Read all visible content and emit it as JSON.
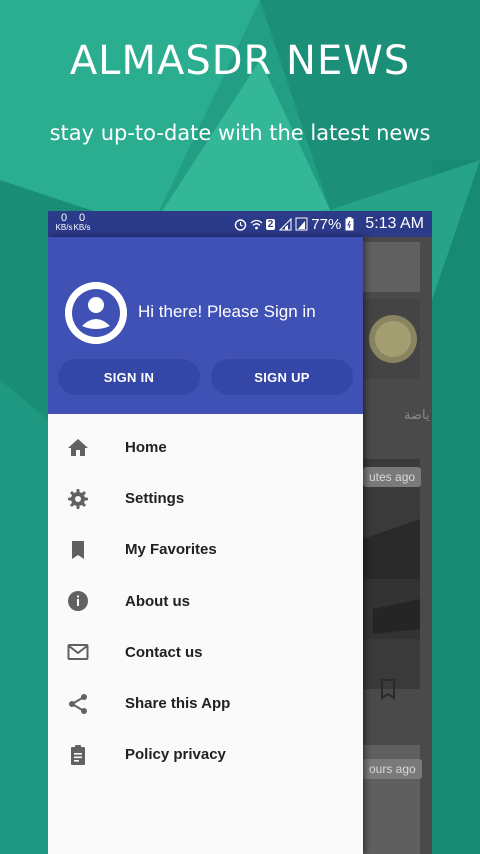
{
  "promo": {
    "title": "ALMASDR NEWS",
    "subtitle": "stay up-to-date with the latest news"
  },
  "statusbar": {
    "net_up": "0",
    "net_down": "0",
    "net_unit": "KB/s",
    "sim_badge": "2",
    "battery_percent": "77%",
    "time": "5:13 AM"
  },
  "drawer": {
    "greeting": "Hi there! Please Sign in",
    "sign_in_label": "SIGN IN",
    "sign_up_label": "SIGN UP",
    "items": [
      {
        "label": "Home",
        "icon": "home-icon"
      },
      {
        "label": "Settings",
        "icon": "gear-icon"
      },
      {
        "label": "My Favorites",
        "icon": "bookmark-icon"
      },
      {
        "label": "About us",
        "icon": "info-icon"
      },
      {
        "label": "Contact us",
        "icon": "mail-icon"
      },
      {
        "label": "Share this App",
        "icon": "share-icon"
      },
      {
        "label": "Policy privacy",
        "icon": "clipboard-icon"
      }
    ]
  },
  "background_feed": {
    "time_label_1": "utes ago",
    "time_label_2": "ours ago",
    "tab_fragment": "ياضة"
  },
  "colors": {
    "drawer_header": "#3f51b5",
    "status_bar": "#2c3a8a",
    "promo_bg": "#1f9e82"
  }
}
